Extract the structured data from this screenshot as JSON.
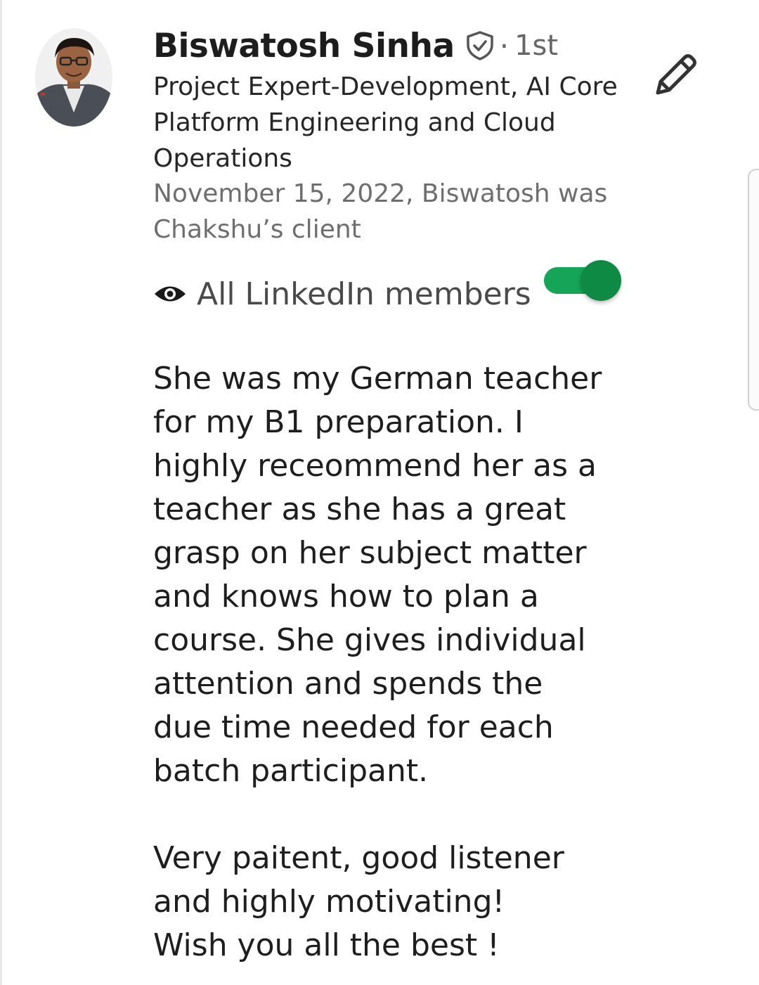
{
  "recommender": {
    "name": "Biswatosh Sinha",
    "verified_icon": "verified-shield-icon",
    "separator": "·",
    "connection_degree": "1st",
    "headline": "Project Expert-Development, AI Core Platform Engineering and Cloud Operations",
    "meta": "November 15, 2022, Biswatosh was Chakshu’s client"
  },
  "actions": {
    "edit_icon": "pencil-icon"
  },
  "visibility": {
    "icon": "eye-icon",
    "label": "All LinkedIn members",
    "toggle_on": true,
    "toggle_color": "#15a458"
  },
  "recommendation": {
    "paragraph_1": "She was my German teacher for my B1 preparation. I highly receommend her as a teacher as she has a great grasp on her subject matter and knows how to plan a course. She gives individual attention and spends the due time needed for each batch participant.",
    "paragraph_2": "Very paitent, good listener\nand highly motivating!\nWish you all the best !"
  }
}
